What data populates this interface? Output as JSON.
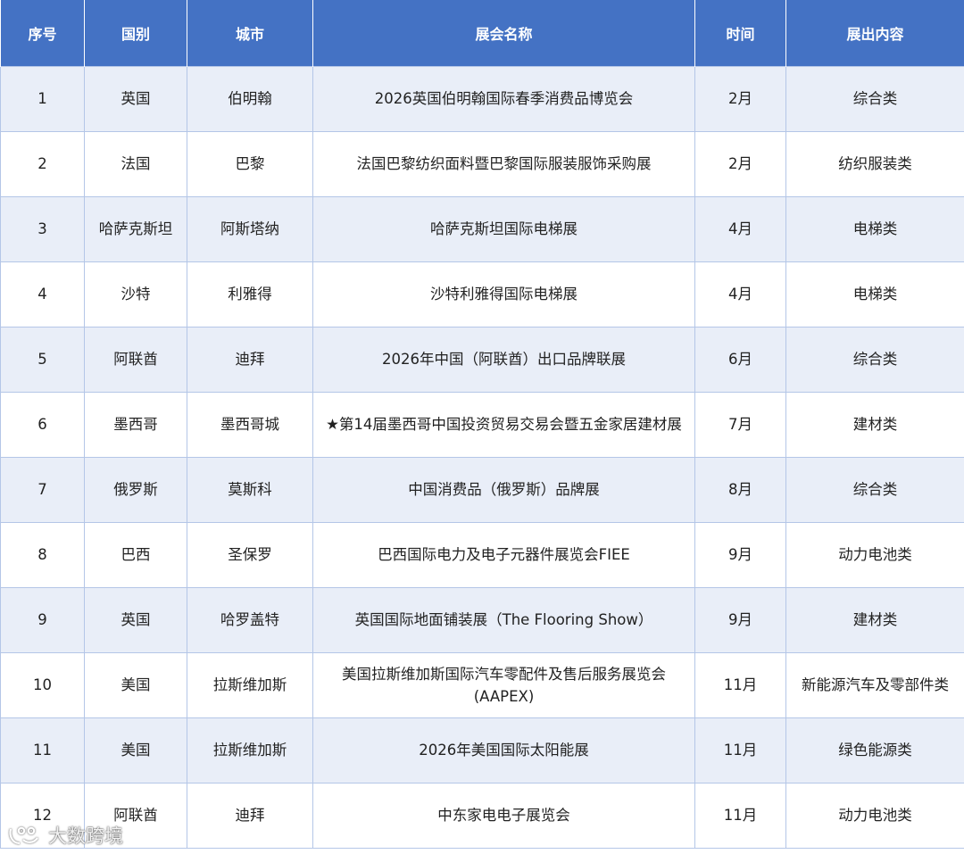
{
  "table": {
    "headers": [
      "序号",
      "国别",
      "城市",
      "展会名称",
      "时间",
      "展出内容"
    ],
    "rows": [
      {
        "no": "1",
        "country": "英国",
        "city": "伯明翰",
        "name": "2026英国伯明翰国际春季消费品博览会",
        "time": "2月",
        "category": "综合类"
      },
      {
        "no": "2",
        "country": "法国",
        "city": "巴黎",
        "name": "法国巴黎纺织面料暨巴黎国际服装服饰采购展",
        "time": "2月",
        "category": "纺织服装类"
      },
      {
        "no": "3",
        "country": "哈萨克斯坦",
        "city": "阿斯塔纳",
        "name": "哈萨克斯坦国际电梯展",
        "time": "4月",
        "category": "电梯类"
      },
      {
        "no": "4",
        "country": "沙特",
        "city": "利雅得",
        "name": "沙特利雅得国际电梯展",
        "time": "4月",
        "category": "电梯类"
      },
      {
        "no": "5",
        "country": "阿联酋",
        "city": "迪拜",
        "name": "2026年中国（阿联酋）出口品牌联展",
        "time": "6月",
        "category": "综合类"
      },
      {
        "no": "6",
        "country": "墨西哥",
        "city": "墨西哥城",
        "name": "★第14届墨西哥中国投资贸易交易会暨五金家居建材展",
        "time": "7月",
        "category": "建材类"
      },
      {
        "no": "7",
        "country": "俄罗斯",
        "city": "莫斯科",
        "name": "中国消费品（俄罗斯）品牌展",
        "time": "8月",
        "category": "综合类"
      },
      {
        "no": "8",
        "country": "巴西",
        "city": "圣保罗",
        "name": "巴西国际电力及电子元器件展览会FIEE",
        "time": "9月",
        "category": "动力电池类"
      },
      {
        "no": "9",
        "country": "英国",
        "city": "哈罗盖特",
        "name": "英国国际地面铺装展（The Flooring Show）",
        "time": "9月",
        "category": "建材类"
      },
      {
        "no": "10",
        "country": "美国",
        "city": "拉斯维加斯",
        "name": "美国拉斯维加斯国际汽车零配件及售后服务展览会(AAPEX)",
        "time": "11月",
        "category": "新能源汽车及零部件类"
      },
      {
        "no": "11",
        "country": "美国",
        "city": "拉斯维加斯",
        "name": "2026年美国国际太阳能展",
        "time": "11月",
        "category": "绿色能源类"
      },
      {
        "no": "12",
        "country": "阿联酋",
        "city": "迪拜",
        "name": "中东家电电子展览会",
        "time": "11月",
        "category": "动力电池类"
      }
    ]
  },
  "watermark": {
    "text": "大数跨境",
    "icon": "logo-mark-icon"
  }
}
